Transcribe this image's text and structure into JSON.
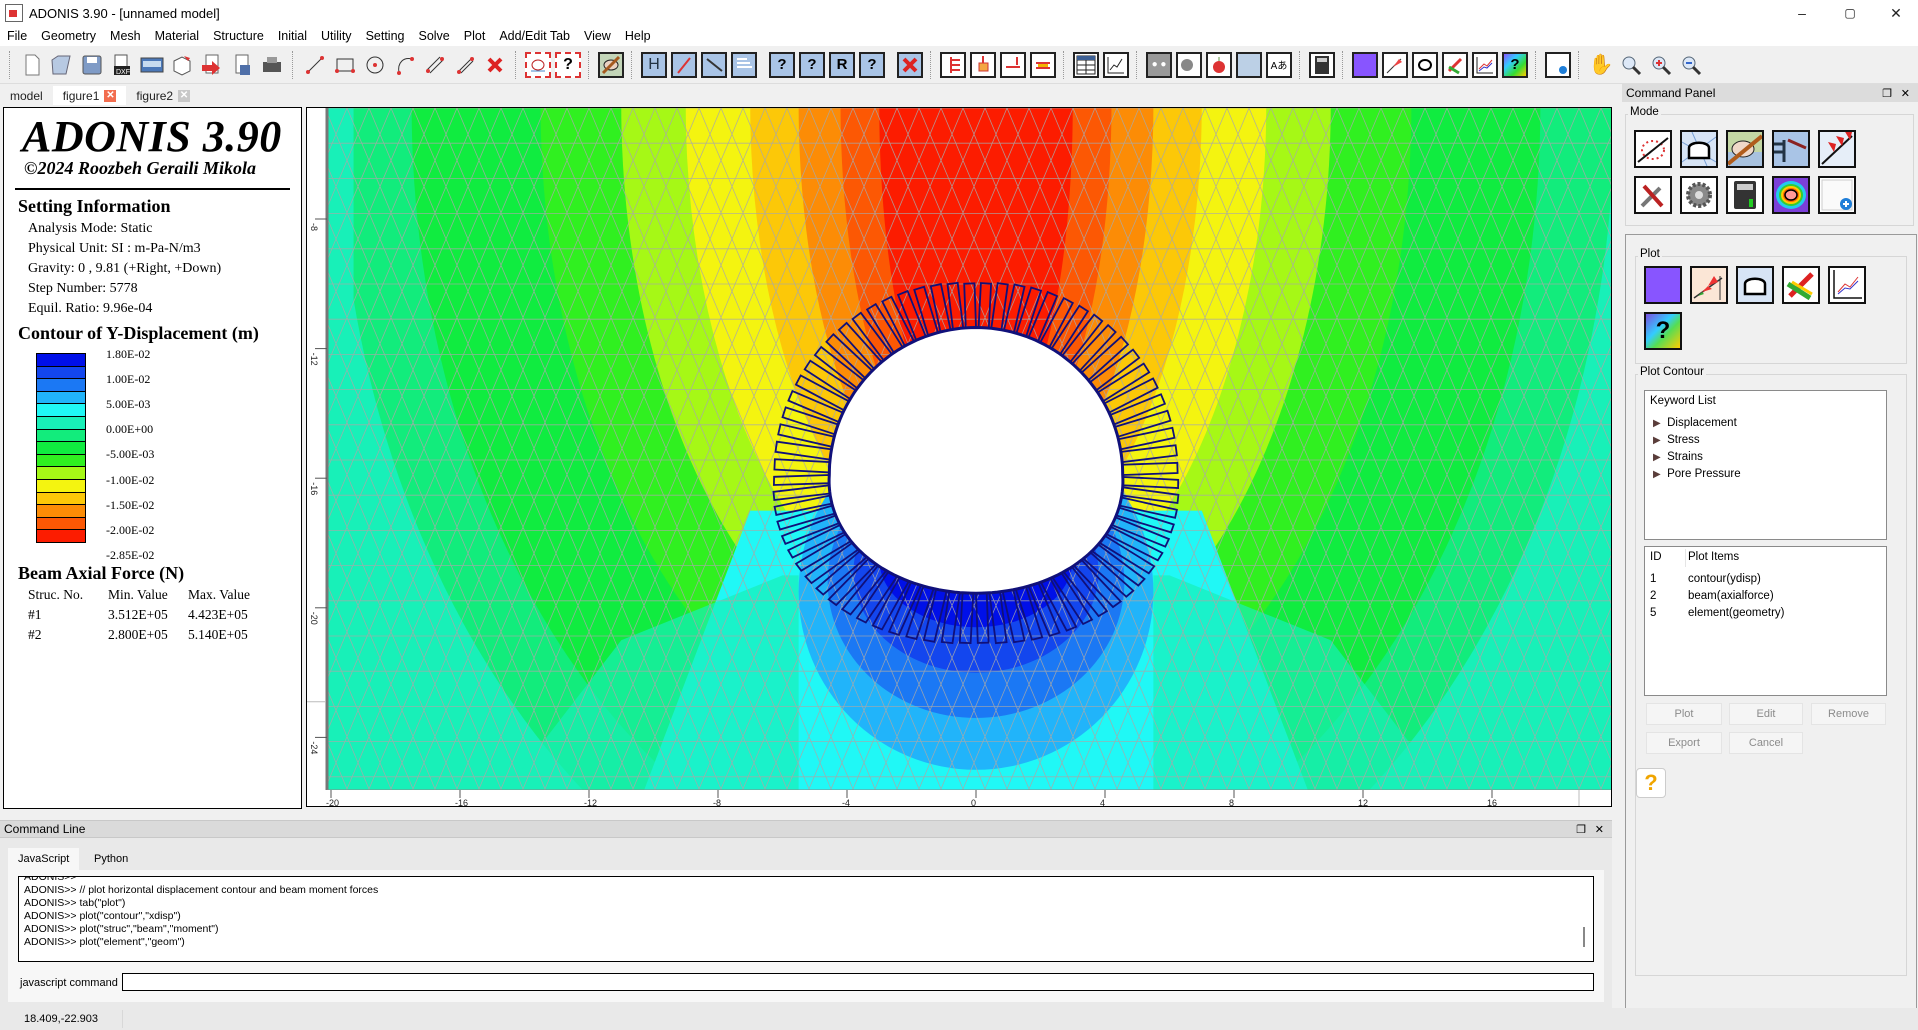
{
  "window": {
    "title": "ADONIS 3.90 - [unnamed model]",
    "controls": {
      "minimize": "–",
      "maximize": "▢",
      "close": "✕"
    }
  },
  "menu": [
    "File",
    "Geometry",
    "Mesh",
    "Material",
    "Structure",
    "Initial",
    "Utility",
    "Setting",
    "Solve",
    "Plot",
    "Add/Edit Tab",
    "View",
    "Help"
  ],
  "toolbar": {
    "groups": [
      [
        "new-file",
        "open-folder",
        "save",
        "import-dxf",
        "export-image",
        "export-3d",
        "run-script",
        "save-script",
        "print"
      ],
      [
        "draw-line",
        "draw-rectangle",
        "draw-circle",
        "draw-arc",
        "draw-double-line",
        "draw-polyline",
        "delete-geometry"
      ],
      [
        "mesh-tunnel",
        "mesh-query"
      ],
      [
        "material"
      ],
      [
        "structure-beam",
        "structure-cable",
        "structure-anchor",
        "structure-liner"
      ],
      [
        "query-1",
        "query-2",
        "query-3",
        "query-4"
      ],
      [
        "delete-structure"
      ],
      [
        "boundary-fix",
        "point-load",
        "beam-load",
        "distributed-load"
      ],
      [
        "table",
        "history-plot"
      ],
      [
        "utility-1",
        "utility-2",
        "utility-3",
        "water-table",
        "text-label"
      ],
      [
        "calculator"
      ],
      [
        "plot-contour",
        "plot-structure",
        "plot-mesh",
        "plot-vector",
        "plot-history",
        "plot-query"
      ],
      [
        "new-tab"
      ],
      [
        "pan-hand",
        "zoom-extent",
        "zoom-in",
        "zoom-out"
      ]
    ]
  },
  "tabs": [
    {
      "label": "model",
      "closable": false,
      "active": false
    },
    {
      "label": "figure1",
      "closable": true,
      "active": true
    },
    {
      "label": "figure2",
      "closable": true,
      "active": false
    }
  ],
  "info_panel": {
    "title": "ADONIS 3.90",
    "copyright": "©2024 Roozbeh Geraili Mikola",
    "setting_heading": "Setting Information",
    "settings": [
      "Analysis Mode: Static",
      "Physical Unit: SI : m-Pa-N/m3",
      "Gravity: 0 , 9.81 (+Right, +Down)",
      "Step Number: 5778",
      "Equil. Ratio: 9.96e-04"
    ],
    "contour_heading": "Contour of Y-Displacement (m)",
    "legend_colors": [
      "#0010e8",
      "#1346ee",
      "#1b78f4",
      "#21b4fa",
      "#20f8f6",
      "#18f0b8",
      "#12ec7c",
      "#10ec40",
      "#30f020",
      "#a6f816",
      "#f4f410",
      "#fcc808",
      "#fc8c06",
      "#fc5804",
      "#fc1c00"
    ],
    "legend_labels": [
      "1.80E-02",
      "1.00E-02",
      "5.00E-03",
      "0.00E+00",
      "-5.00E-03",
      "-1.00E-02",
      "-1.50E-02",
      "-2.00E-02",
      "-2.85E-02"
    ],
    "beam_heading": "Beam Axial Force (N)",
    "beam_columns": [
      "Struc. No.",
      "Min. Value",
      "Max. Value"
    ],
    "beam_rows": [
      [
        "#1",
        "3.512E+05",
        "4.423E+05"
      ],
      [
        "#2",
        "2.800E+05",
        "5.140E+05"
      ]
    ]
  },
  "plot": {
    "x_ticks": [
      "-20",
      "-16",
      "-12",
      "-8",
      "-4",
      "0",
      "4",
      "8",
      "12",
      "16"
    ],
    "y_ticks": [
      "-8",
      "-12",
      "-16",
      "-20",
      "-24"
    ],
    "contour_quantity": "ydisp",
    "colors": {
      "mesh": "#a8a8a8",
      "liner": "#10107a",
      "opening": "#ffffff"
    }
  },
  "command_panel": {
    "title": "Command Panel",
    "mode_label": "Mode",
    "mode_icons": [
      "geometry-mode",
      "mesh-mode",
      "material-mode",
      "structure-mode",
      "loading-mode",
      "utility-mode",
      "solve-mode",
      "calculator-mode",
      "plot-mode",
      "new-tab-mode"
    ],
    "plot_label": "Plot",
    "plot_icons": [
      "contour-plot",
      "structure-plot",
      "mesh-plot",
      "vector-plot",
      "history-plot",
      "query-plot"
    ],
    "plot_contour_label": "Plot Contour",
    "keyword_header": "Keyword List",
    "keywords": [
      "Displacement",
      "Stress",
      "Strains",
      "Pore Pressure"
    ],
    "items_header_id": "ID",
    "items_header_name": "Plot Items",
    "items": [
      {
        "id": "1",
        "name": "contour(ydisp)"
      },
      {
        "id": "2",
        "name": "beam(axialforce)"
      },
      {
        "id": "5",
        "name": "element(geometry)"
      }
    ],
    "buttons": {
      "plot": "Plot",
      "edit": "Edit",
      "remove": "Remove",
      "export": "Export",
      "cancel": "Cancel"
    },
    "help_icon": "?"
  },
  "command_line": {
    "title": "Command Line",
    "tabs": [
      "JavaScript",
      "Python"
    ],
    "active_tab": "JavaScript",
    "history": [
      "ADONIS>>",
      "ADONIS>> // plot horizontal displacement contour and beam moment forces",
      "ADONIS>> tab(\"plot\")",
      "ADONIS>> plot(\"contour\",\"xdisp\")",
      "ADONIS>> plot(\"struc\",\"beam\",\"moment\")",
      "ADONIS>> plot(\"element\",\"geom\")"
    ],
    "input_label": "javascript command",
    "input_value": ""
  },
  "status": {
    "coordinates": "18.409,-22.903"
  }
}
